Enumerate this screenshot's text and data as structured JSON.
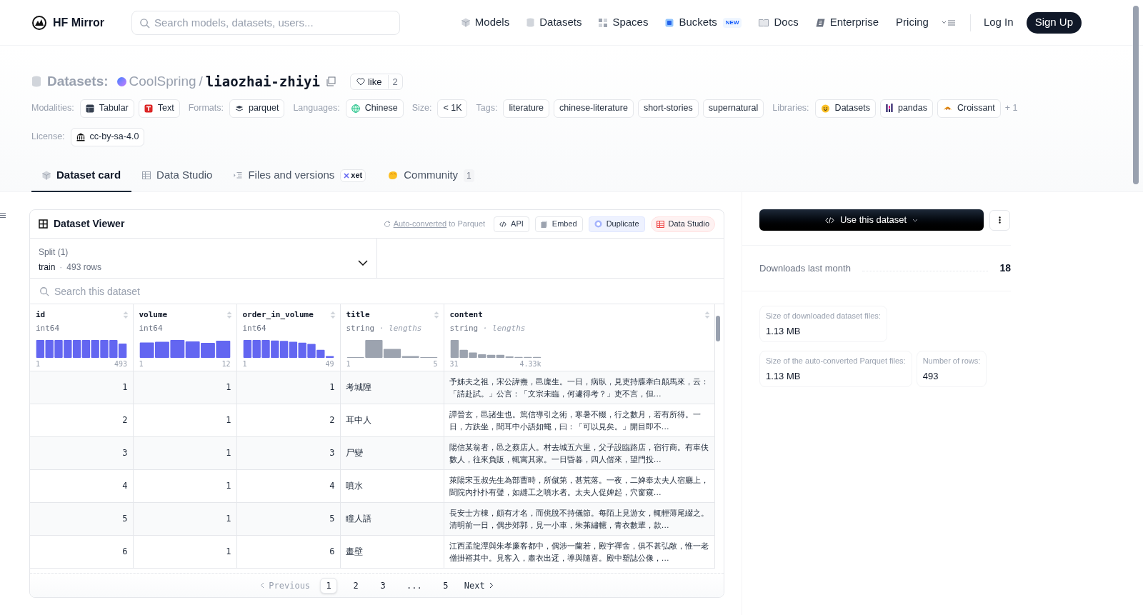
{
  "nav": {
    "brand": "HF Mirror",
    "search_placeholder": "Search models, datasets, users...",
    "links": [
      {
        "label": "Models"
      },
      {
        "label": "Datasets"
      },
      {
        "label": "Spaces"
      },
      {
        "label": "Buckets",
        "badge": "NEW"
      },
      {
        "label": "Docs"
      },
      {
        "label": "Enterprise"
      },
      {
        "label": "Pricing"
      }
    ],
    "login": "Log In",
    "signup": "Sign Up"
  },
  "repo": {
    "prefix": "Datasets:",
    "owner": "CoolSpring",
    "separator": "/",
    "name": "liaozhai-zhiyi",
    "like_label": "like",
    "like_count": "2"
  },
  "meta": [
    {
      "label": "Modalities:",
      "chips": [
        "Tabular",
        "Text"
      ]
    },
    {
      "label": "Formats:",
      "chips": [
        "parquet"
      ]
    },
    {
      "label": "Languages:",
      "chips": [
        "Chinese"
      ]
    },
    {
      "label": "Size:",
      "chips": [
        "< 1K"
      ]
    },
    {
      "label": "Tags:",
      "chips": [
        "literature",
        "chinese-literature",
        "short-stories",
        "supernatural"
      ]
    },
    {
      "label": "Libraries:",
      "chips": [
        "Datasets",
        "pandas",
        "Croissant"
      ],
      "more": "+ 1"
    },
    {
      "label": "License:",
      "chips": [
        "cc-by-sa-4.0"
      ]
    }
  ],
  "tabs": [
    {
      "label": "Dataset card",
      "selected": true
    },
    {
      "label": "Data Studio",
      "selected": false
    },
    {
      "label": "Files and versions",
      "badge": "xet",
      "selected": false
    },
    {
      "label": "Community",
      "count": "1",
      "selected": false
    }
  ],
  "viewer": {
    "title": "Dataset Viewer",
    "auto_link": "Auto-converted",
    "auto_rest": "to Parquet",
    "buttons": [
      {
        "label": "API",
        "kind": "api"
      },
      {
        "label": "Embed",
        "kind": "embed"
      },
      {
        "label": "Duplicate",
        "kind": "duplicate"
      },
      {
        "label": "Data Studio",
        "kind": "studio"
      }
    ],
    "split_label": "Split (1)",
    "split_name": "train",
    "split_sep": "·",
    "split_rows": "493 rows",
    "search_placeholder": "Search this dataset",
    "columns": [
      {
        "name": "id",
        "type": "int64",
        "kind": "int",
        "min": "1",
        "max": "493"
      },
      {
        "name": "volume",
        "type": "int64",
        "kind": "int",
        "min": "1",
        "max": "12"
      },
      {
        "name": "order_in_volume",
        "type": "int64",
        "kind": "int",
        "min": "1",
        "max": "49"
      },
      {
        "name": "title",
        "type": "string",
        "hint": "· lengths",
        "kind": "string",
        "min": "1",
        "max": "5"
      },
      {
        "name": "content",
        "type": "string",
        "hint": "· lengths",
        "kind": "string",
        "min": "31",
        "max": "4.33k"
      }
    ],
    "rows": [
      [
        "1",
        "1",
        "1",
        "考城隍",
        "予姊夫之祖，宋公諱燾，邑廩生。一日，病臥，見吏持牒牽白顛馬來，云：「請赴試。」公言：「文宗未臨，何遽得考？」吏不言，但…"
      ],
      [
        "2",
        "1",
        "2",
        "耳中人",
        "譚晉玄，邑諸生也。篤信導引之術，寒暑不輟，行之數月，若有所得。一日，方趺坐，聞耳中小語如蠅，曰：「可以見矣。」開目即不…"
      ],
      [
        "3",
        "1",
        "3",
        "尸變",
        "陽信某翁者，邑之蔡店人。村去城五六里，父子設臨路店，宿行商。有車伕數人，往來負販，輒寓其家。一日昏暮，四人偕來，望門投…"
      ],
      [
        "4",
        "1",
        "4",
        "噴水",
        "萊陽宋玉叔先生為部曹時，所僦第，甚荒落。一夜，二婢奉太夫人宿廳上，聞院內扑扑有聲，如縫工之噴水者。太夫人促婢起，穴窗窺…"
      ],
      [
        "5",
        "1",
        "5",
        "瞳人語",
        "長安士方棟，頗有才名，而佻脫不持儀節。每陌上見游女，輒輕薄尾綴之。清明前一日，偶步郊郭，見一小車，朱茀繡幰，青衣數輩，款…"
      ],
      [
        "6",
        "1",
        "6",
        "畫壁",
        "江西孟龍潭與朱孝廉客都中，偶涉一蘭若，殿宇禪舍，俱不甚弘敞，惟一老僧掛褡其中。見客入，肅衣出迓，導與隨喜。殿中塑誌公像，…"
      ]
    ],
    "previous": {
      "label": "Previous",
      "disabled": true
    },
    "pages": [
      {
        "label": "1",
        "selected": true
      },
      {
        "label": "2",
        "selected": false
      },
      {
        "label": "3",
        "selected": false
      },
      {
        "label": "...",
        "selected": false
      },
      {
        "label": "5",
        "selected": false
      }
    ],
    "next": {
      "label": "Next",
      "disabled": false
    }
  },
  "sidebar": {
    "use_button": "Use this dataset",
    "downloads_label": "Downloads last month",
    "downloads_value": "18",
    "sizes": [
      {
        "label": "Size of downloaded dataset files:",
        "value": "1.13 MB"
      },
      {
        "label": "Size of the auto-converted Parquet files:",
        "value": "1.13 MB"
      },
      {
        "label": "Number of rows:",
        "value": "493"
      }
    ]
  }
}
